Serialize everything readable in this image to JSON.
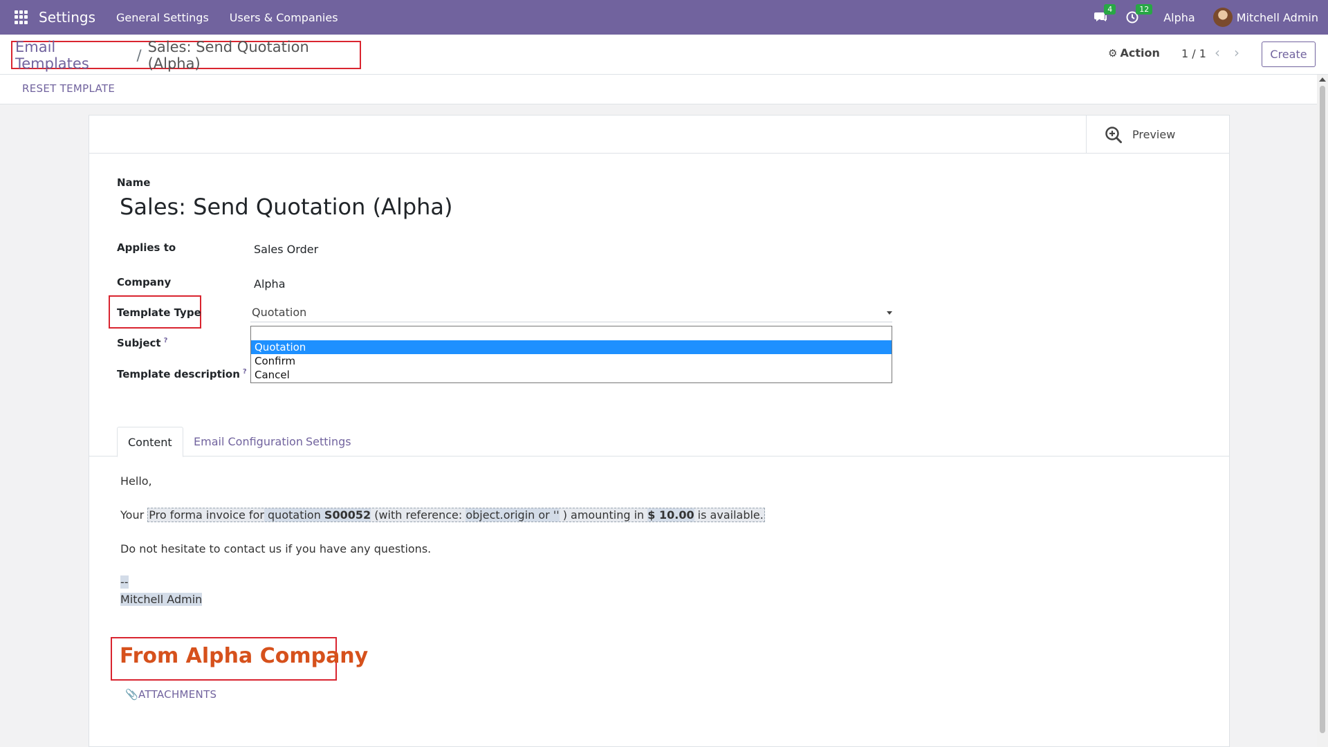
{
  "navbar": {
    "app_name": "Settings",
    "menu": [
      "General Settings",
      "Users & Companies"
    ],
    "messages_badge": "4",
    "activities_badge": "12",
    "company": "Alpha",
    "user": "Mitchell Admin"
  },
  "control_panel": {
    "breadcrumb_parent": "Email Templates",
    "breadcrumb_sep": "/",
    "breadcrumb_current": "Sales: Send Quotation (Alpha)",
    "action_label": "Action",
    "pager": "1 / 1",
    "create_label": "Create"
  },
  "statusbar": {
    "reset_label": "RESET TEMPLATE"
  },
  "button_box": {
    "preview_label": "Preview"
  },
  "form": {
    "name_label": "Name",
    "name_value": "Sales: Send Quotation (Alpha)",
    "applies_to_label": "Applies to",
    "applies_to_value": "Sales Order",
    "company_label": "Company",
    "company_value": "Alpha",
    "template_type_label": "Template Type",
    "template_type_value": "Quotation",
    "template_type_options": [
      "Quotation",
      "Confirm",
      "Cancel"
    ],
    "subject_label": "Subject",
    "description_label": "Template description",
    "help_mark": "?"
  },
  "tabs": [
    "Content",
    "Email Configuration",
    "Settings"
  ],
  "content": {
    "greeting": "Hello,",
    "line_your": "Your ",
    "line_part1": "Pro forma invoice for",
    "line_part2": " quotation ",
    "line_quote": "S00052",
    "line_part3": " (with reference: ",
    "line_ref": "object.origin or ''",
    "line_part4": " ) amounting in ",
    "line_amount": "$ 10.00",
    "line_part5": " is available.",
    "contact_line": "Do not hesitate to contact us if you have any questions.",
    "sig_dash": "--",
    "sig_name": "Mitchell Admin",
    "from_company": "From Alpha Company",
    "attachments_label": "ATTACHMENTS"
  },
  "colors": {
    "brand": "#71639e",
    "highlight_red": "#d9242f",
    "company_orange": "#d6511c",
    "select_blue": "#1e90ff"
  }
}
